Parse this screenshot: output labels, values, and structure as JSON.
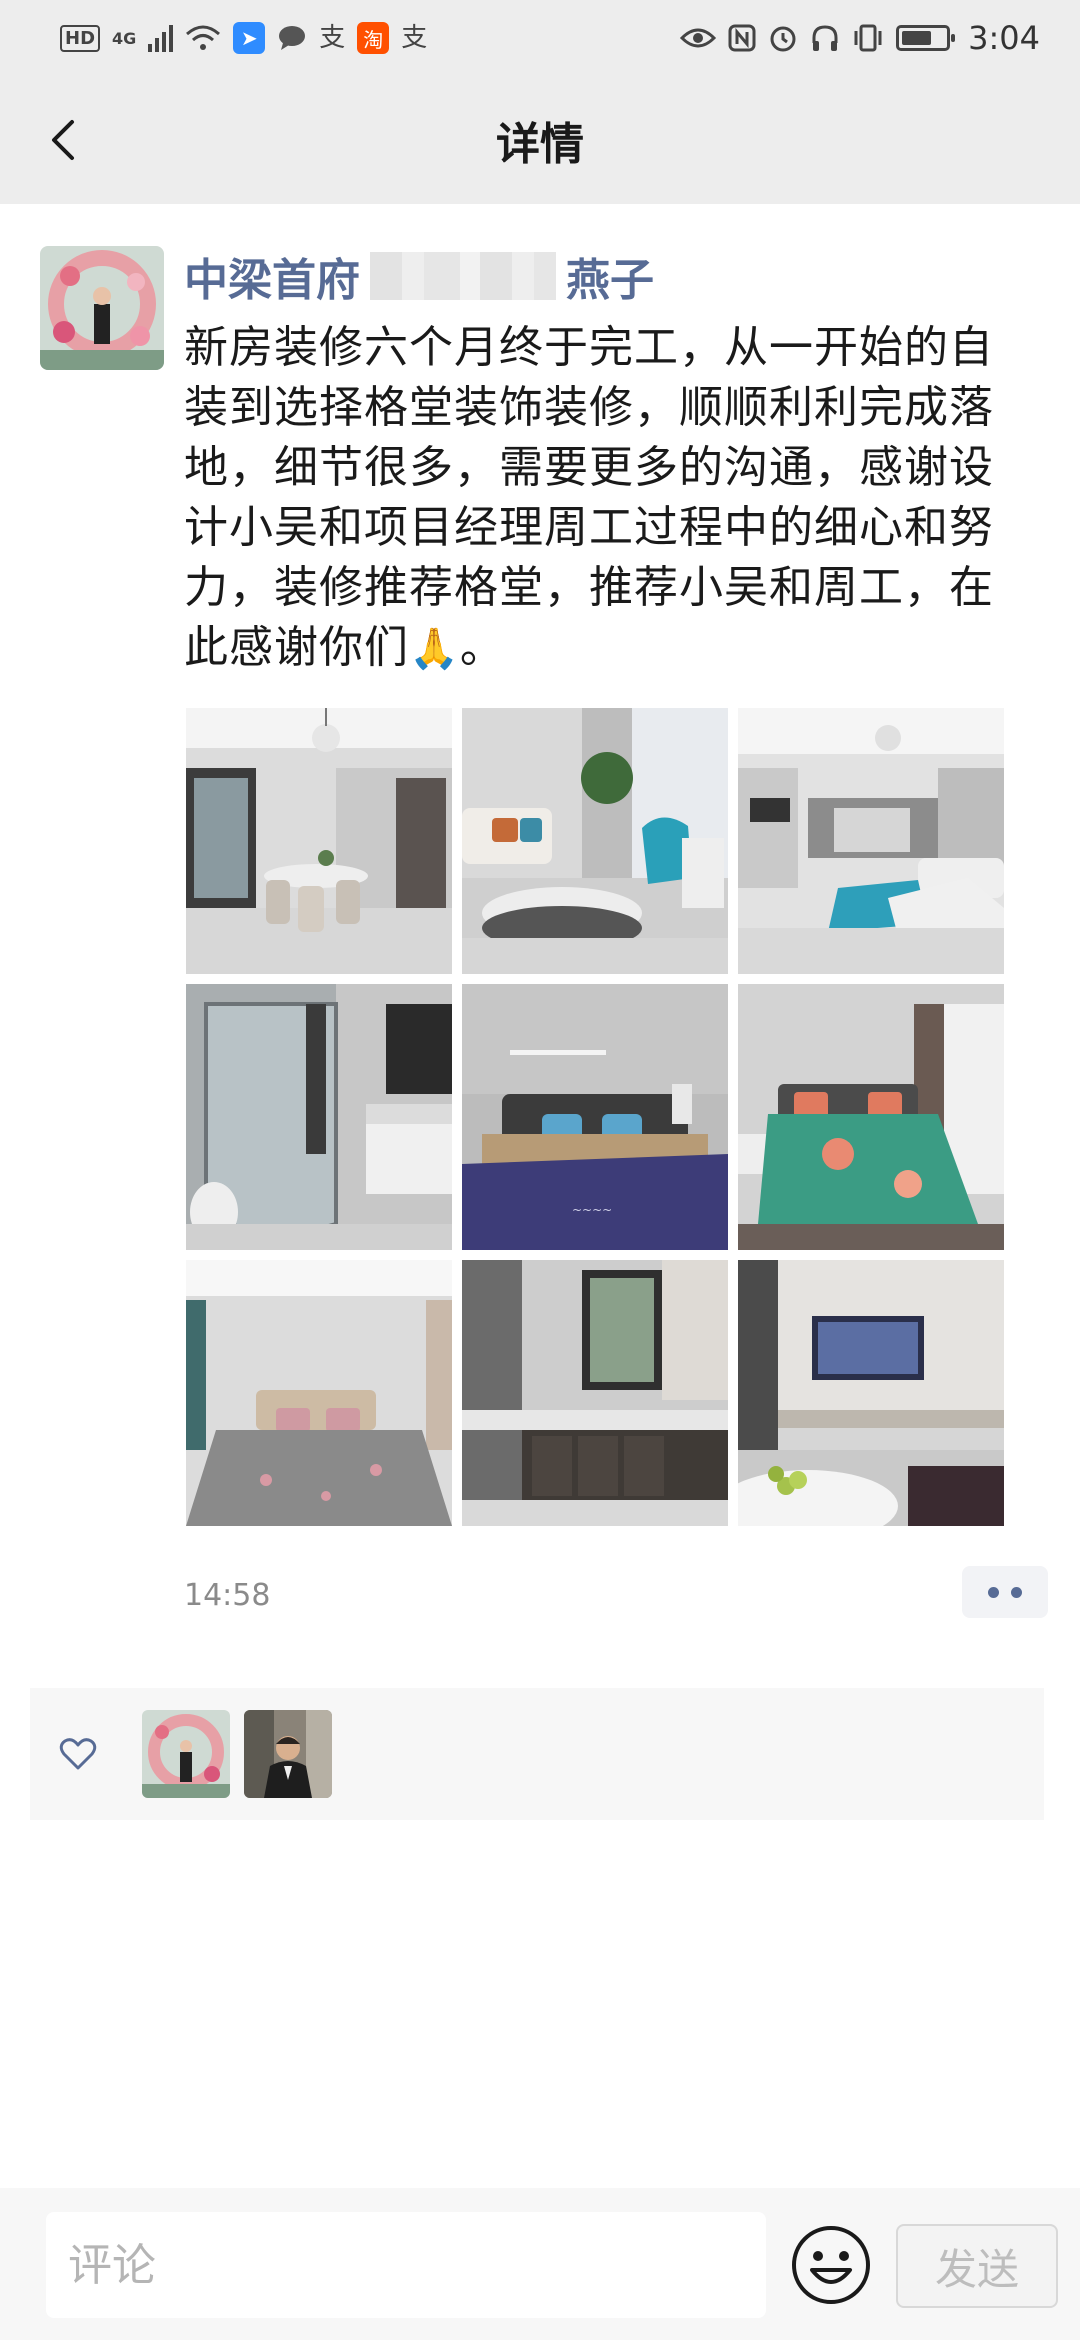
{
  "status_bar": {
    "time": "3:04",
    "hd_label": "HD",
    "network_label": "4G",
    "left_icons": [
      "hd-icon",
      "signal-icon",
      "wifi-icon",
      "app-tip-icon",
      "message-icon",
      "alipay-icon",
      "taobao-icon",
      "alipay-icon"
    ],
    "right_icons": [
      "eye-icon",
      "nfc-icon",
      "alarm-icon",
      "headphones-icon",
      "vibrate-icon",
      "battery-icon"
    ],
    "zhi_char": "支",
    "taobao_char": "淘"
  },
  "nav": {
    "title": "详情",
    "back_icon": "chevron-left-icon"
  },
  "post": {
    "author_prefix": "中梁首府",
    "author_suffix": "燕子",
    "text": "新房装修六个月终于完工，从一开始的自装到选择格堂装饰装修，顺顺利利完成落地，细节很多，需要更多的沟通，感谢设计小吴和项目经理周工过程中的细心和努力，装修推荐格堂，推荐小吴和周工，在此感谢你们",
    "text_emoji": "🙏",
    "text_end": "。",
    "time": "14:58",
    "photos": [
      "dining-room",
      "living-room-sofa",
      "living-room-wide",
      "bathroom-shower",
      "bedroom-grey",
      "bedroom-green",
      "bedroom-bright",
      "kitchen",
      "living-room-tv"
    ]
  },
  "likes": {
    "icon": "heart-icon",
    "avatars": [
      "avatar-woman-flowers",
      "avatar-man-suit"
    ]
  },
  "comment_bar": {
    "placeholder": "评论",
    "send_label": "发送",
    "emoji_icon": "smiley-icon"
  },
  "colors": {
    "bar_bg": "#ededed",
    "link": "#576b95",
    "likes_bg": "#f7f7f7"
  }
}
